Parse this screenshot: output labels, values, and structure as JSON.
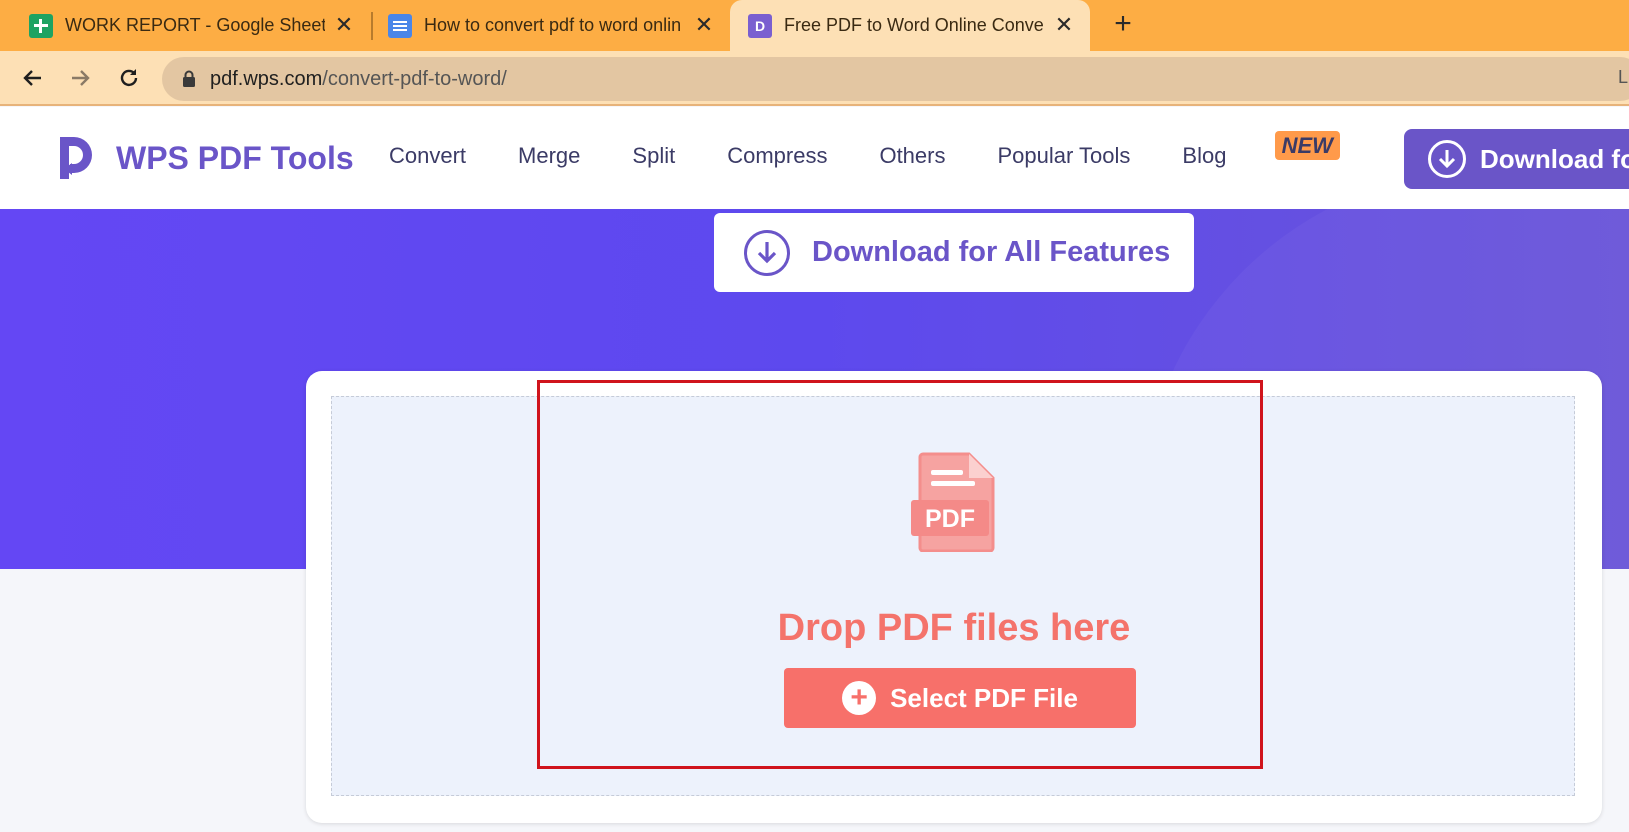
{
  "browser": {
    "tabs": [
      {
        "title": "WORK REPORT - Google Sheets",
        "icon": "google-sheets-icon"
      },
      {
        "title": "How to convert pdf to word onlin",
        "icon": "google-docs-icon"
      },
      {
        "title": "Free PDF to Word Online Convert",
        "icon": "wps-pdf-icon",
        "favicon_letter": "D"
      }
    ],
    "close_glyph": "✕",
    "new_tab_glyph": "+",
    "url_host": "pdf.wps.com",
    "url_path": "/convert-pdf-to-word/",
    "url_trailing": "L"
  },
  "site": {
    "brand": "WPS PDF Tools",
    "nav": [
      "Convert",
      "Merge",
      "Split",
      "Compress",
      "Others",
      "Popular Tools",
      "Blog"
    ],
    "new_badge": "NEW",
    "header_download": "Download fo",
    "hero_download": "Download for All Features"
  },
  "upload": {
    "file_icon_label": "PDF",
    "drop_text": "Drop PDF files here",
    "select_button": "Select PDF File",
    "plus_glyph": "+"
  },
  "colors": {
    "tab_strip": "#fdad44",
    "brand_purple": "#6a55c8",
    "hero": "#6447f4",
    "accent_coral": "#f7706a",
    "highlight_red": "#d0141c"
  }
}
